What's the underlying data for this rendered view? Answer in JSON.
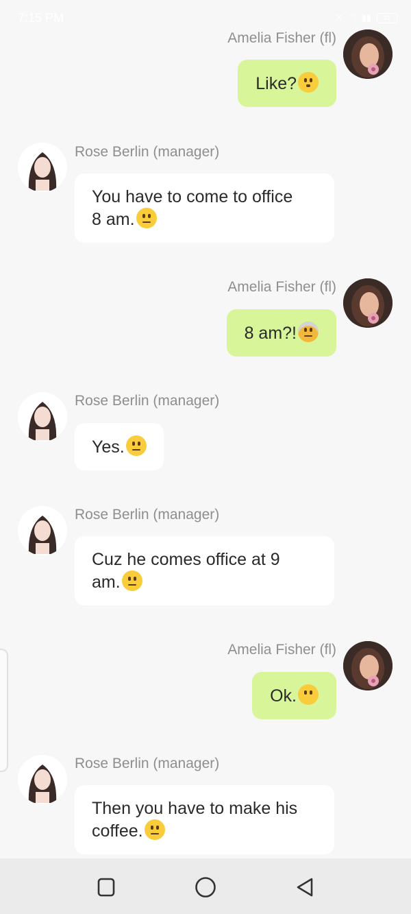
{
  "status_bar": {
    "time": "7:15 PM",
    "battery": "22"
  },
  "messages": [
    {
      "sender": "Amelia Fisher (fl)",
      "text": "Like?",
      "emoji": "hushed-face"
    },
    {
      "sender": "Rose Berlin (manager)",
      "text_line1": "You have to come to office",
      "text_line2": "8 am.",
      "emoji": "neutral-face"
    },
    {
      "sender": "Amelia Fisher (fl)",
      "text": "8 am?!",
      "emoji": "exploding-head"
    },
    {
      "sender": "Rose Berlin (manager)",
      "text": "Yes.",
      "emoji": "neutral-face"
    },
    {
      "sender": "Rose Berlin (manager)",
      "text_line1": "Cuz he comes office at 9",
      "text_line2": "am.",
      "emoji": "neutral-face"
    },
    {
      "sender": "Amelia Fisher (fl)",
      "text": "Ok.",
      "emoji": "face-without-mouth"
    },
    {
      "sender": "Rose Berlin (manager)",
      "text_line1": "Then you have to make his",
      "text_line2": "coffee.",
      "emoji": "neutral-face"
    }
  ],
  "nav": {
    "recent": "square-icon",
    "home": "circle-icon",
    "back": "triangle-back-icon"
  }
}
